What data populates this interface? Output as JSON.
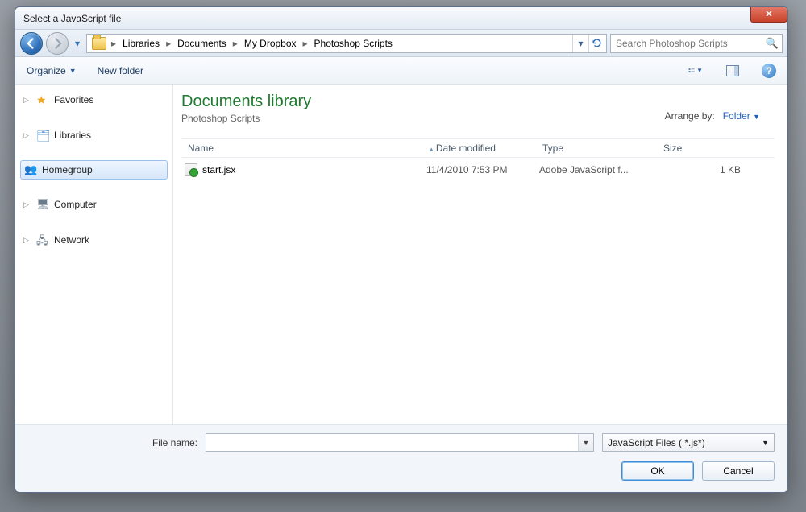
{
  "window_title": "Select a JavaScript file",
  "breadcrumbs": [
    "Libraries",
    "Documents",
    "My Dropbox",
    "Photoshop Scripts"
  ],
  "search_placeholder": "Search Photoshop Scripts",
  "toolbar": {
    "organize": "Organize",
    "new_folder": "New folder"
  },
  "sidebar": {
    "favorites": "Favorites",
    "libraries": "Libraries",
    "homegroup": "Homegroup",
    "computer": "Computer",
    "network": "Network"
  },
  "library": {
    "title": "Documents library",
    "subtitle": "Photoshop Scripts",
    "arrange_label": "Arrange by:",
    "arrange_value": "Folder"
  },
  "columns": {
    "name": "Name",
    "date": "Date modified",
    "type": "Type",
    "size": "Size"
  },
  "files": [
    {
      "name": "start.jsx",
      "date": "11/4/2010 7:53 PM",
      "type": "Adobe JavaScript f...",
      "size": "1 KB"
    }
  ],
  "footer": {
    "file_name_label": "File name:",
    "file_name_value": "",
    "filter": "JavaScript Files ( *.js*)",
    "ok": "OK",
    "cancel": "Cancel"
  }
}
